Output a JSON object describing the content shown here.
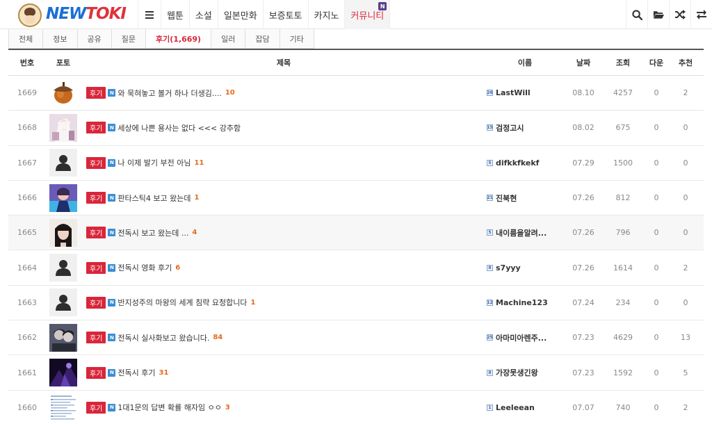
{
  "logo": {
    "part1": "NEW",
    "part2": "TOKI"
  },
  "nav": {
    "items": [
      {
        "label": "웹툰"
      },
      {
        "label": "소설"
      },
      {
        "label": "일본만화"
      },
      {
        "label": "보증토토"
      },
      {
        "label": "카지노"
      },
      {
        "label": "커뮤니티",
        "badge": "N",
        "active": true
      }
    ]
  },
  "tools": [
    "search-icon",
    "folder-open-icon",
    "shuffle-icon",
    "exchange-icon"
  ],
  "tabs": [
    {
      "label": "전체"
    },
    {
      "label": "정보"
    },
    {
      "label": "공유"
    },
    {
      "label": "질문"
    },
    {
      "label": "후기(1,669)",
      "active": true
    },
    {
      "label": "일러"
    },
    {
      "label": "잡담"
    },
    {
      "label": "기타"
    }
  ],
  "table": {
    "headers": {
      "num": "번호",
      "photo": "포토",
      "subject": "제목",
      "name": "이름",
      "date": "날짜",
      "views": "조회",
      "down": "다운",
      "rec": "추천"
    },
    "tag_label": "후기",
    "new_label": "N",
    "rows": [
      {
        "num": "1669",
        "photo": "acorn",
        "title": "와 묵혀놓고 볼거 하나 더생김....",
        "comments": "10",
        "level": "26",
        "name": "LastWill",
        "date": "08.10",
        "views": "4257",
        "down": "0",
        "rec": "2"
      },
      {
        "num": "1668",
        "photo": "anime-white",
        "title": "세상에 나쁜 용사는 없다 <<< 강추함",
        "comments": "",
        "level": "15",
        "name": "검정고시",
        "date": "08.02",
        "views": "675",
        "down": "0",
        "rec": "0"
      },
      {
        "num": "1667",
        "photo": "avatar",
        "title": "나 이제 발기 부전 아님",
        "comments": "11",
        "level": "5",
        "name": "difkkfkekf",
        "date": "07.29",
        "views": "1500",
        "down": "0",
        "rec": "0"
      },
      {
        "num": "1666",
        "photo": "anime-purple",
        "title": "판타스틱4 보고 왔는데",
        "comments": "1",
        "level": "21",
        "name": "진북현",
        "date": "07.26",
        "views": "812",
        "down": "0",
        "rec": "0"
      },
      {
        "num": "1665",
        "photo": "portrait",
        "title": "전독시 보고 왔는데 ...",
        "comments": "4",
        "level": "5",
        "name": "내이름을알려...",
        "date": "07.26",
        "views": "796",
        "down": "0",
        "rec": "0",
        "highlight": true
      },
      {
        "num": "1664",
        "photo": "avatar",
        "title": "전독시 영화 후기",
        "comments": "6",
        "level": "8",
        "name": "s7yyy",
        "date": "07.26",
        "views": "1614",
        "down": "0",
        "rec": "2"
      },
      {
        "num": "1663",
        "photo": "avatar",
        "title": "반지성주의 마왕의 세계 침략 요청합니다",
        "comments": "1",
        "level": "12",
        "name": "Machine123",
        "date": "07.24",
        "views": "234",
        "down": "0",
        "rec": "0"
      },
      {
        "num": "1662",
        "photo": "dark-couple",
        "title": "전독시 실사화보고 왔습니다.",
        "comments": "84",
        "level": "25",
        "name": "아마미아렌주...",
        "date": "07.23",
        "views": "4629",
        "down": "0",
        "rec": "13"
      },
      {
        "num": "1661",
        "photo": "dark-purple",
        "title": "전독시 후기",
        "comments": "31",
        "level": "8",
        "name": "가장못생긴왕",
        "date": "07.23",
        "views": "1592",
        "down": "0",
        "rec": "5"
      },
      {
        "num": "1660",
        "photo": "doc",
        "title": "1대1문의 답변 확률 해자임 ㅇㅇ",
        "comments": "3",
        "level": "1",
        "name": "Leeleean",
        "date": "07.07",
        "views": "740",
        "down": "0",
        "rec": "2"
      }
    ]
  }
}
